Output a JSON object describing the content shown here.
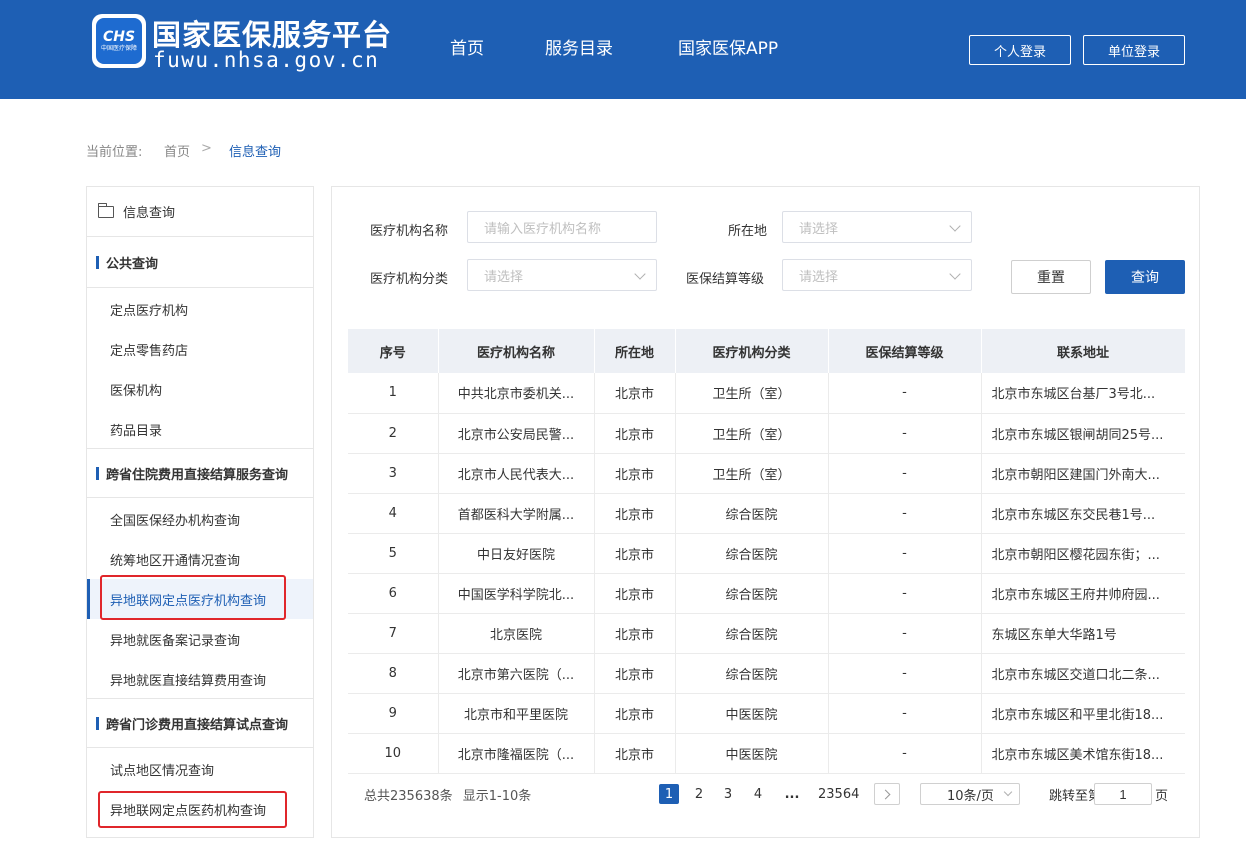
{
  "header": {
    "logo_text": "CHS",
    "logo_sub": "中国医疗保障",
    "title": "国家医保服务平台",
    "domain": "fuwu.nhsa.gov.cn",
    "nav": [
      "首页",
      "服务目录",
      "国家医保APP"
    ],
    "personal_login": "个人登录",
    "unit_login": "单位登录"
  },
  "breadcrumb": {
    "prefix": "当前位置:",
    "home": "首页",
    "separator": ">",
    "current": "信息查询"
  },
  "sidebar": {
    "title": "信息查询",
    "sections": [
      {
        "title": "公共查询",
        "items": [
          "定点医疗机构",
          "定点零售药店",
          "医保机构",
          "药品目录"
        ]
      },
      {
        "title": "跨省住院费用直接结算服务查询",
        "items": [
          "全国医保经办机构查询",
          "统筹地区开通情况查询",
          "异地联网定点医疗机构查询",
          "异地就医备案记录查询",
          "异地就医直接结算费用查询"
        ]
      },
      {
        "title": "跨省门诊费用直接结算试点查询",
        "items": [
          "试点地区情况查询",
          "异地联网定点医药机构查询"
        ]
      }
    ],
    "active_item": "异地联网定点医疗机构查询"
  },
  "filters": {
    "name_label": "医疗机构名称",
    "name_placeholder": "请输入医疗机构名称",
    "location_label": "所在地",
    "location_placeholder": "请选择",
    "category_label": "医疗机构分类",
    "category_placeholder": "请选择",
    "level_label": "医保结算等级",
    "level_placeholder": "请选择",
    "reset": "重置",
    "query": "查询"
  },
  "table": {
    "headers": [
      "序号",
      "医疗机构名称",
      "所在地",
      "医疗机构分类",
      "医保结算等级",
      "联系地址"
    ],
    "rows": [
      [
        "1",
        "中共北京市委机关...",
        "北京市",
        "卫生所（室）",
        "-",
        "北京市东城区台基厂3号北..."
      ],
      [
        "2",
        "北京市公安局民警...",
        "北京市",
        "卫生所（室）",
        "-",
        "北京市东城区银闸胡同25号..."
      ],
      [
        "3",
        "北京市人民代表大...",
        "北京市",
        "卫生所（室）",
        "-",
        "北京市朝阳区建国门外南大..."
      ],
      [
        "4",
        "首都医科大学附属...",
        "北京市",
        "综合医院",
        "-",
        "北京市东城区东交民巷1号..."
      ],
      [
        "5",
        "中日友好医院",
        "北京市",
        "综合医院",
        "-",
        "北京市朝阳区樱花园东街；..."
      ],
      [
        "6",
        "中国医学科学院北...",
        "北京市",
        "综合医院",
        "-",
        "北京市东城区王府井帅府园..."
      ],
      [
        "7",
        "北京医院",
        "北京市",
        "综合医院",
        "-",
        "东城区东单大华路1号"
      ],
      [
        "8",
        "北京市第六医院（...",
        "北京市",
        "综合医院",
        "-",
        "北京市东城区交道口北二条..."
      ],
      [
        "9",
        "北京市和平里医院",
        "北京市",
        "中医医院",
        "-",
        "北京市东城区和平里北街18..."
      ],
      [
        "10",
        "北京市隆福医院（...",
        "北京市",
        "中医医院",
        "-",
        "北京市东城区美术馆东街18..."
      ]
    ]
  },
  "pagination": {
    "total_text": "总共235638条",
    "display_text": "显示1-10条",
    "pages": [
      "1",
      "2",
      "3",
      "4",
      "...",
      "23564"
    ],
    "current_page": "1",
    "page_size": "10条/页",
    "jump_label": "跳转至第",
    "jump_value": "1",
    "jump_suffix": "页"
  },
  "colors": {
    "brand": "#1e5fb4",
    "highlight_box": "#e0262b"
  }
}
